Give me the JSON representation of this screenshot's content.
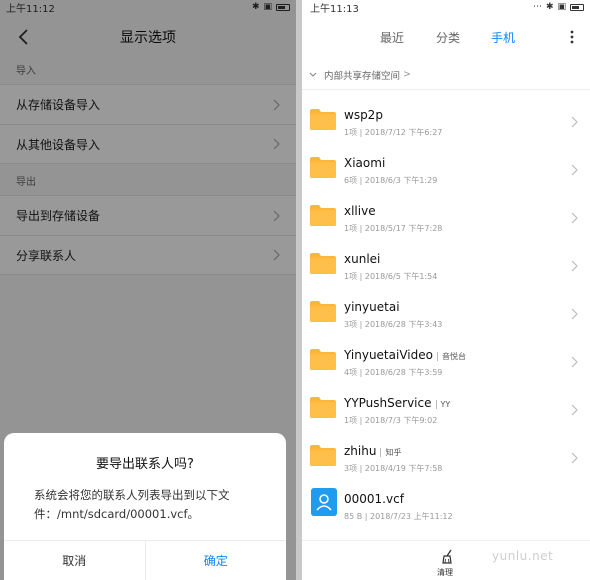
{
  "left": {
    "status": {
      "time": "上午11:12"
    },
    "title": "显示选项",
    "sections": [
      {
        "header": "导入",
        "items": [
          {
            "label": "从存储设备导入"
          },
          {
            "label": "从其他设备导入"
          }
        ]
      },
      {
        "header": "导出",
        "items": [
          {
            "label": "导出到存储设备"
          },
          {
            "label": "分享联系人"
          }
        ]
      }
    ],
    "dialog": {
      "title": "要导出联系人吗?",
      "message": "系统会将您的联系人列表导出到以下文件：/mnt/sdcard/00001.vcf。",
      "cancel": "取消",
      "confirm": "确定"
    }
  },
  "right": {
    "status": {
      "time": "上午11:13"
    },
    "tabs": [
      {
        "label": "最近",
        "active": false
      },
      {
        "label": "分类",
        "active": false
      },
      {
        "label": "手机",
        "active": true
      }
    ],
    "breadcrumb": "内部共享存储空间",
    "breadcrumb_sep": ">",
    "files": [
      {
        "name": "wsp2p",
        "tag": "",
        "meta": "1项 | 2018/7/12 下午6:27",
        "type": "folder"
      },
      {
        "name": "Xiaomi",
        "tag": "",
        "meta": "6项 | 2018/6/3 下午1:29",
        "type": "folder"
      },
      {
        "name": "xllive",
        "tag": "",
        "meta": "1项 | 2018/5/17 下午7:28",
        "type": "folder"
      },
      {
        "name": "xunlei",
        "tag": "",
        "meta": "1项 | 2018/6/5 下午1:54",
        "type": "folder"
      },
      {
        "name": "yinyuetai",
        "tag": "",
        "meta": "3项 | 2018/6/28 下午3:43",
        "type": "folder"
      },
      {
        "name": "YinyuetaiVideo",
        "tag": "音悦台",
        "meta": "4项 | 2018/6/28 下午3:59",
        "type": "folder"
      },
      {
        "name": "YYPushService",
        "tag": "YY",
        "meta": "1项 | 2018/7/3 下午9:02",
        "type": "folder"
      },
      {
        "name": "zhihu",
        "tag": "知乎",
        "meta": "3项 | 2018/4/19 下午7:58",
        "type": "folder"
      },
      {
        "name": "00001.vcf",
        "tag": "",
        "meta": "85 B | 2018/7/23 上午11:12",
        "type": "vcf"
      }
    ],
    "bottom": {
      "clean_label": "清理"
    },
    "watermark": "yunlu.net"
  },
  "colors": {
    "accent": "#0d84ff",
    "folder": "#ffb638",
    "vcf": "#1f9bf0"
  },
  "icons": [
    "back-arrow-icon",
    "chevron-right-icon",
    "more-vert-icon",
    "folder-icon",
    "vcf-file-icon",
    "broom-icon",
    "bluetooth-icon",
    "battery-icon"
  ]
}
